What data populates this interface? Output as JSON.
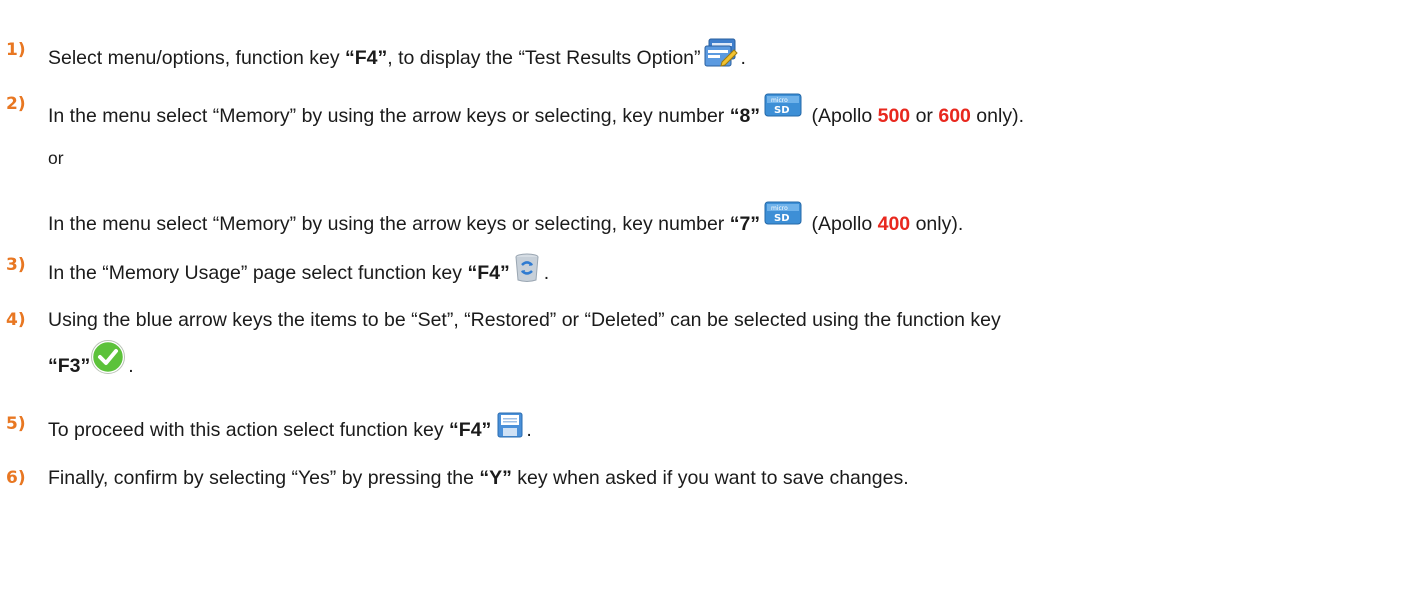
{
  "colors": {
    "step_number": "#e87722",
    "highlight": "#e8281e",
    "text": "#1b1b1b"
  },
  "steps": [
    {
      "number": "1)",
      "text_a": "Select menu/options, function key ",
      "key": "“F4”",
      "text_b": ", to display the “Test Results Option”",
      "icon": "test-results-option-icon",
      "end": "."
    },
    {
      "number": "2)",
      "text_a": "In the menu select “Memory” by using the arrow keys or selecting, key number ",
      "key": "“8”",
      "icon": "micro-sd-memory-icon",
      "text_b": " (Apollo ",
      "model_1": "500",
      "or_word": " or ",
      "model_2": "600",
      "text_c": " only).",
      "separator": "or",
      "alt_text_a": "In the menu select “Memory” by using the arrow keys or selecting, key number ",
      "alt_key": "“7”",
      "alt_icon": "micro-sd-memory-icon",
      "alt_text_b": " (Apollo ",
      "alt_model": "400",
      "alt_text_c": " only)."
    },
    {
      "number": "3)",
      "text_a": "In the “Memory Usage” page select function key ",
      "key": "“F4”",
      "icon": "memory-recycle-icon",
      "end": "."
    },
    {
      "number": "4)",
      "text_a": "Using the blue arrow keys the items to be “Set”, “Restored” or “Deleted” can be selected using the function key",
      "key": "“F3”",
      "icon": "green-check-icon",
      "end": "."
    },
    {
      "number": "5)",
      "text_a": "To proceed with this action select function key ",
      "key": "“F4”",
      "icon": "save-disk-icon",
      "end": "."
    },
    {
      "number": "6)",
      "text_a": "Finally, confirm by selecting “Yes” by pressing the ",
      "key": "“Y”",
      "text_b": " key when asked if you want to save changes."
    }
  ]
}
